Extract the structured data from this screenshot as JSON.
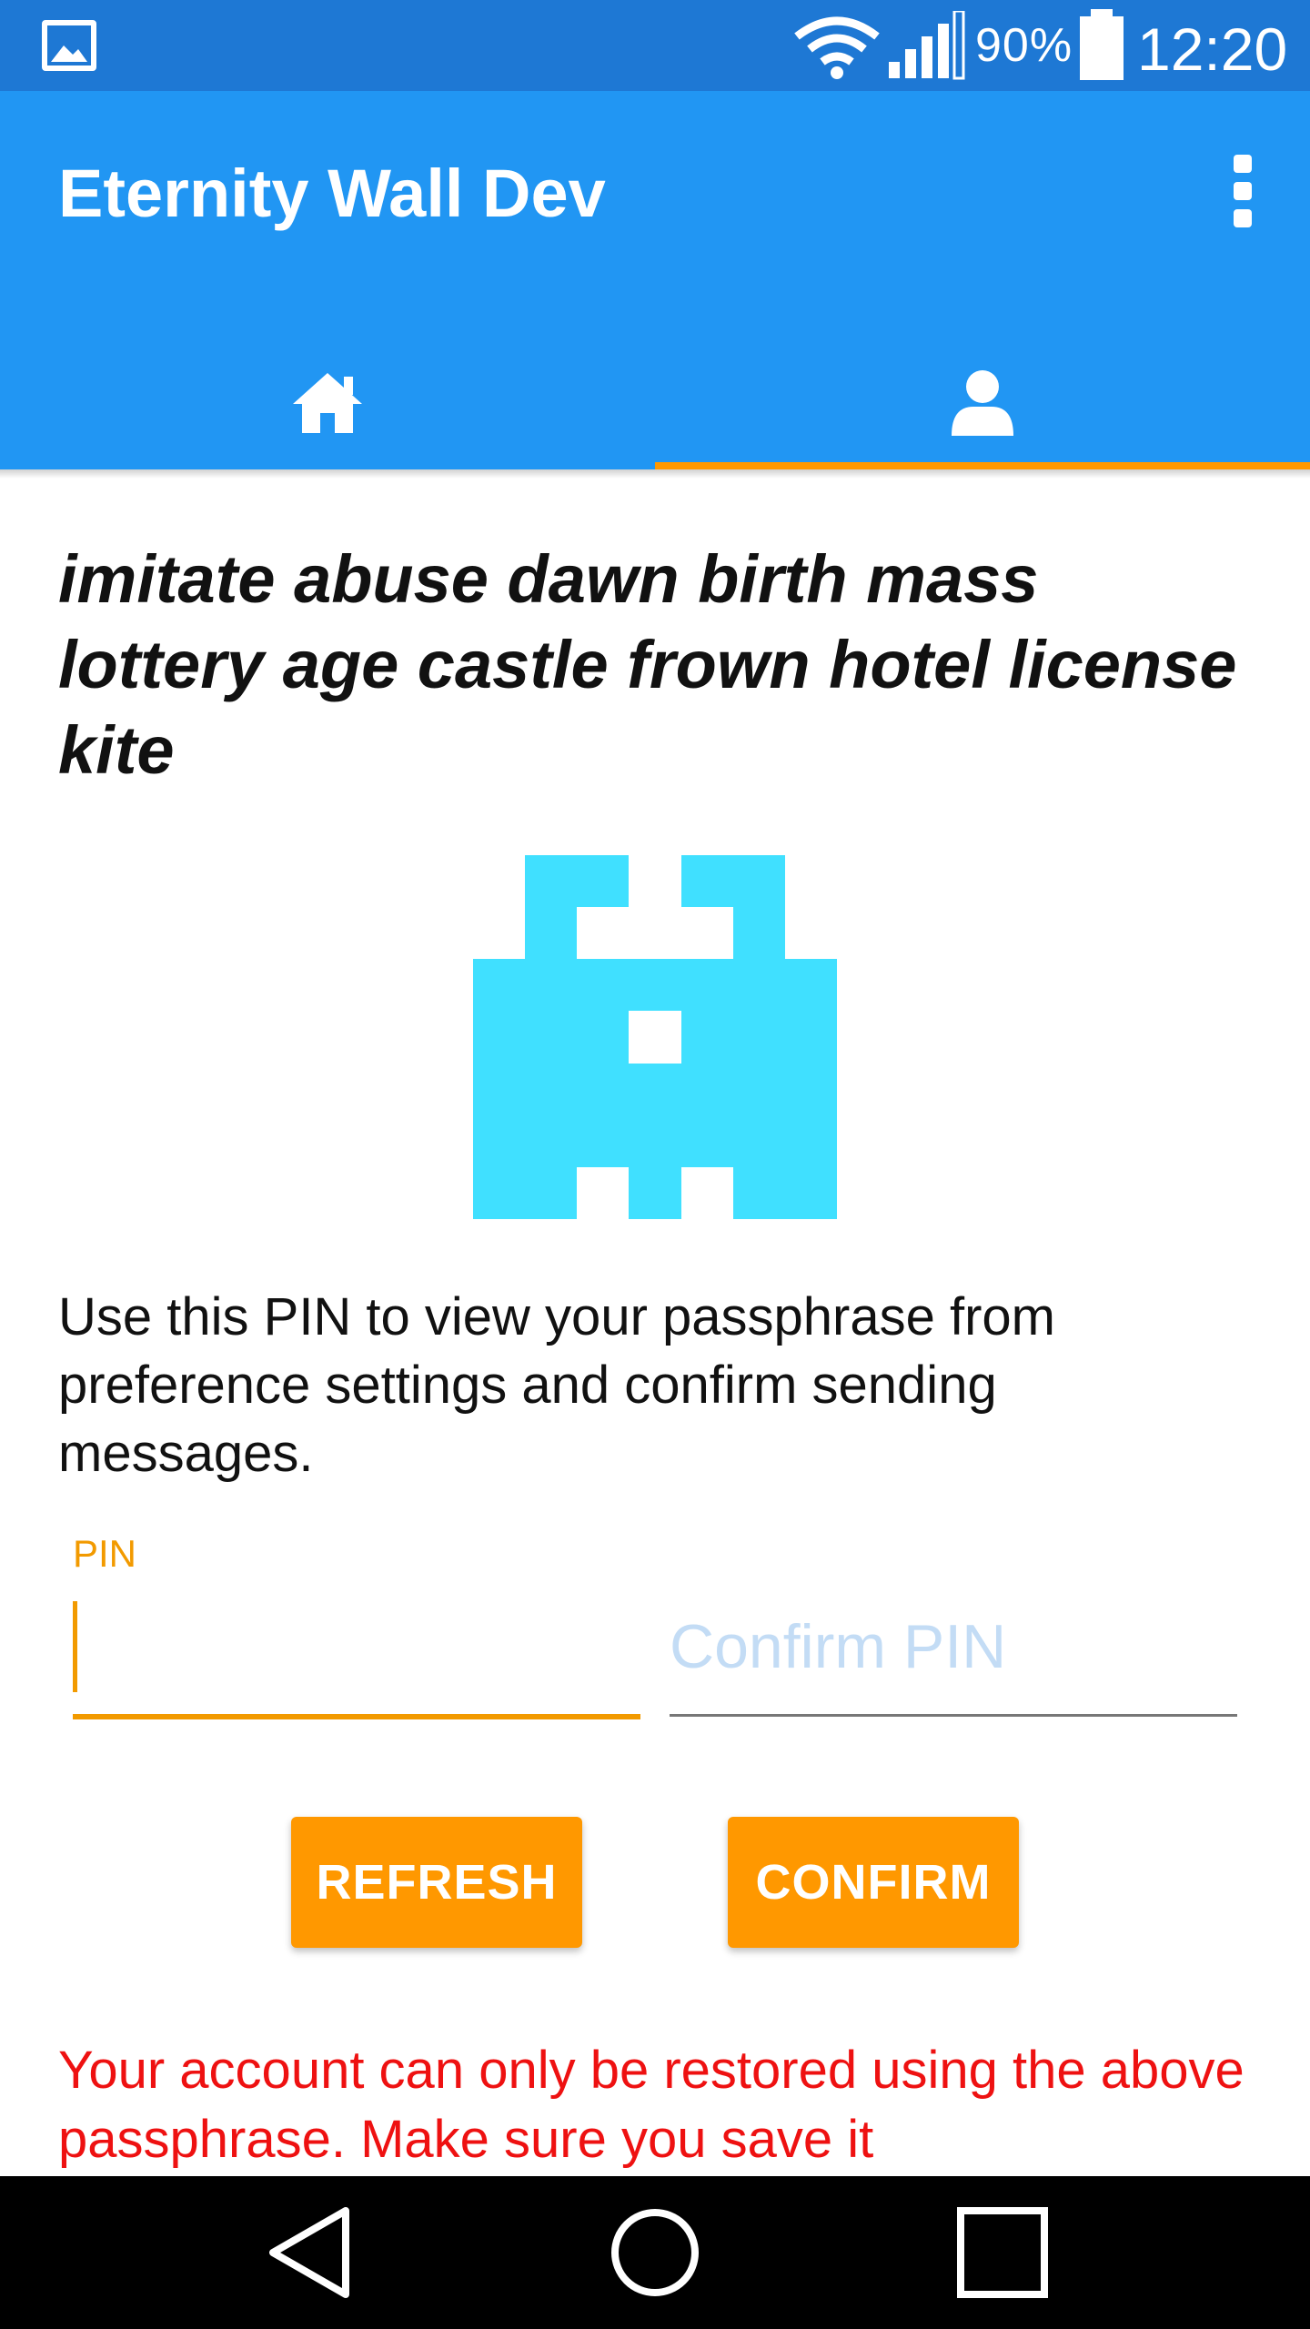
{
  "status_bar": {
    "battery_percent": "90%",
    "time": "12:20",
    "icons": [
      "gallery-icon",
      "wifi-icon",
      "signal-icon",
      "battery-icon"
    ]
  },
  "app_bar": {
    "title": "Eternity Wall Dev",
    "menu_icon": "more-vert-icon",
    "tabs": [
      {
        "icon": "home-icon",
        "selected": false
      },
      {
        "icon": "user-icon",
        "selected": true
      }
    ]
  },
  "profile": {
    "passphrase": "imitate abuse dawn birth mass lottery age castle frown hotel license kite",
    "identicon_color": "#40e0ff",
    "pin_info": "Use this PIN to view your passphrase from preference settings and confirm sending messages.",
    "pin_label": "PIN",
    "pin_value": "",
    "confirm_pin_placeholder": "Confirm PIN",
    "refresh_label": "REFRESH",
    "confirm_label": "CONFIRM",
    "warning": "Your account can only be restored using the above passphrase. Make sure you save it"
  },
  "colors": {
    "status_bar": "#1e78d4",
    "app_bar": "#2196f3",
    "accent": "#ff9800",
    "warning": "#ee1111"
  },
  "nav_bar": {
    "icons": [
      "back-icon",
      "home-circle-icon",
      "recents-icon"
    ]
  }
}
